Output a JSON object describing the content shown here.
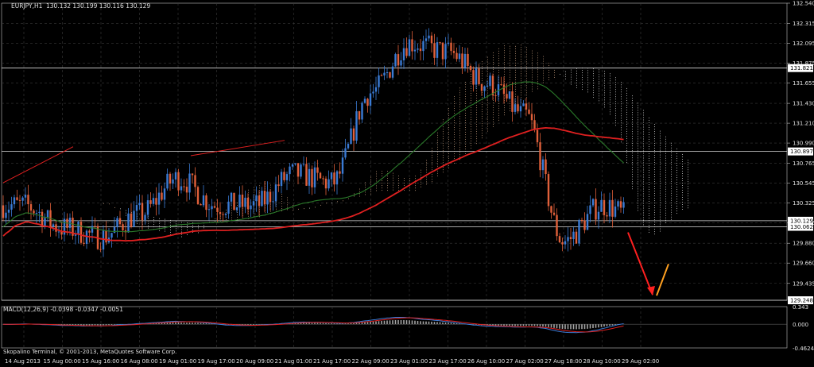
{
  "header": {
    "symbol_label": "EURJPY,H1",
    "ohlc": "130.132 130.199 130.116 130.129"
  },
  "indicator": {
    "macd_label": "MACD(12,26,9) -0.0398 -0.0347 -0.0051",
    "copyright": "Skopalino Terminal, © 2001-2013, MetaQuotes Software Corp."
  },
  "colors": {
    "background": "#000000",
    "grid": "#3a3a3a",
    "candle_up": "#3a7bd5",
    "candle_down": "#e0603a",
    "ma_red": "#e02020",
    "ma_green": "#2a7a2a",
    "cloud_tan": "#c8a080",
    "cloud_white": "#e0e0e0",
    "arrow_red": "#ff2020",
    "arrow_orange": "#ffa020",
    "macd_line": "#3a7bd5",
    "macd_signal": "#e02020",
    "macd_hist": "#cfcfcf"
  },
  "chart_data": {
    "type": "candlestick",
    "symbol": "EURJPY",
    "timeframe": "H1",
    "ylim": [
      129.248,
      132.54
    ],
    "y_ticks": [
      132.54,
      132.315,
      132.095,
      131.875,
      131.655,
      131.43,
      131.21,
      130.99,
      130.765,
      130.545,
      130.325,
      130.105,
      129.88,
      129.66,
      129.435
    ],
    "x_ticks": [
      "14 Aug 2013",
      "15 Aug 00:00",
      "15 Aug 16:00",
      "16 Aug 08:00",
      "19 Aug 01:00",
      "19 Aug 17:00",
      "20 Aug 09:00",
      "21 Aug 01:00",
      "21 Aug 17:00",
      "22 Aug 09:00",
      "23 Aug 01:00",
      "23 Aug 17:00",
      "26 Aug 10:00",
      "27 Aug 02:00",
      "27 Aug 18:00",
      "28 Aug 10:00",
      "29 Aug 02:00"
    ],
    "horizontal_levels": [
      131.821,
      130.897,
      130.129,
      130.062,
      129.248
    ],
    "close_path": [
      {
        "t": "14 Aug 2013",
        "price": 130.3
      },
      {
        "t": "15 Aug 00:00",
        "price": 130.05
      },
      {
        "t": "15 Aug 16:00",
        "price": 129.95
      },
      {
        "t": "16 Aug 08:00",
        "price": 130.2
      },
      {
        "t": "19 Aug 01:00",
        "price": 130.6
      },
      {
        "t": "19 Aug 17:00",
        "price": 130.3
      },
      {
        "t": "20 Aug 09:00",
        "price": 130.3
      },
      {
        "t": "21 Aug 01:00",
        "price": 130.65
      },
      {
        "t": "21 Aug 17:00",
        "price": 130.55
      },
      {
        "t": "22 Aug 09:00",
        "price": 131.55
      },
      {
        "t": "23 Aug 01:00",
        "price": 132.1
      },
      {
        "t": "23 Aug 17:00",
        "price": 132.0
      },
      {
        "t": "26 Aug 10:00",
        "price": 131.65
      },
      {
        "t": "27 Aug 02:00",
        "price": 131.3
      },
      {
        "t": "27 Aug 18:00",
        "price": 129.9
      },
      {
        "t": "28 Aug 10:00",
        "price": 130.3
      },
      {
        "t": "29 Aug 02:00",
        "price": 130.129
      }
    ],
    "macd": {
      "label": "MACD(12,26,9)",
      "values": [
        -0.0398,
        -0.0347,
        -0.0051
      ],
      "ylim": [
        -0.4624,
        0.343
      ],
      "y_ticks": [
        0.343,
        0.0,
        -0.4624
      ]
    }
  }
}
